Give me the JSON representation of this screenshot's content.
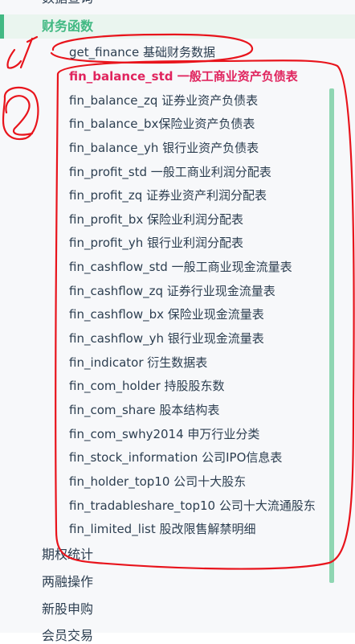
{
  "nav": {
    "top_item_label": "数据查询",
    "section_title": "财务函数",
    "sub_items": [
      {
        "label": "get_finance 基础财务数据",
        "active": false
      },
      {
        "label": "fin_balance_std 一般工商业资产负债表",
        "active": true
      },
      {
        "label": "fin_balance_zq 证券业资产负债表",
        "active": false
      },
      {
        "label": "fin_balance_bx保险业资产负债表",
        "active": false
      },
      {
        "label": "fin_balance_yh 银行业资产负债表",
        "active": false
      },
      {
        "label": "fin_profit_std 一般工商业利润分配表",
        "active": false
      },
      {
        "label": "fin_profit_zq 证券业资产利润分配表",
        "active": false
      },
      {
        "label": "fin_profit_bx 保险业利润分配表",
        "active": false
      },
      {
        "label": "fin_profit_yh 银行业利润分配表",
        "active": false
      },
      {
        "label": "fin_cashflow_std 一般工商业现金流量表",
        "active": false
      },
      {
        "label": "fin_cashflow_zq 证券行业现金流量表",
        "active": false
      },
      {
        "label": "fin_cashflow_bx 保险业现金流量表",
        "active": false
      },
      {
        "label": "fin_cashflow_yh 银行业现金流量表",
        "active": false
      },
      {
        "label": "fin_indicator 衍生数据表",
        "active": false
      },
      {
        "label": "fin_com_holder 持股股东数",
        "active": false
      },
      {
        "label": "fin_com_share 股本结构表",
        "active": false
      },
      {
        "label": "fin_com_swhy2014 申万行业分类",
        "active": false
      },
      {
        "label": "fin_stock_information 公司IPO信息表",
        "active": false
      },
      {
        "label": "fin_holder_top10 公司十大股东",
        "active": false
      },
      {
        "label": "fin_tradableshare_top10 公司十大流通股东",
        "active": false
      },
      {
        "label": "fin_limited_list 股改限售解禁明细",
        "active": false
      }
    ],
    "after_items": [
      "期权统计",
      "两融操作",
      "新股申购",
      "会员交易"
    ]
  },
  "annotations": {
    "label_1": "1",
    "label_2": "2",
    "ink_color": "#e8141c"
  },
  "colors": {
    "accent": "#42b983",
    "active_link": "#e0245e"
  }
}
